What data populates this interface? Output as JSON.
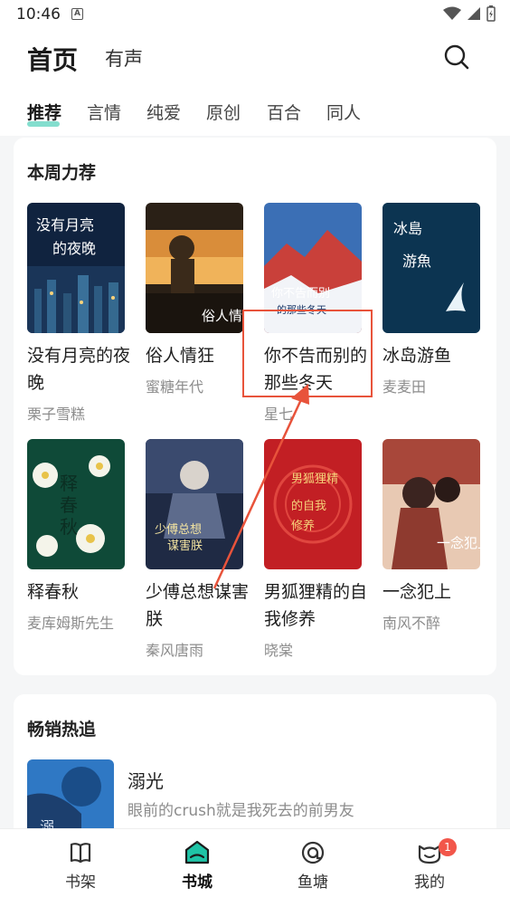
{
  "status_bar": {
    "time": "10:46",
    "notification_letter": "A"
  },
  "header": {
    "title": "首页",
    "audio_tab": "有声"
  },
  "category_tabs": [
    "推荐",
    "言情",
    "纯爱",
    "原创",
    "百合",
    "同人"
  ],
  "weekly_picks": {
    "title": "本周力荐",
    "books": [
      {
        "title": "没有月亮的夜晚",
        "author": "栗子雪糕",
        "cover_text": "没有月亮的夜晚"
      },
      {
        "title": "俗人情狂",
        "author": "蜜糖年代",
        "cover_text": "俗人情狂"
      },
      {
        "title": "你不告而别的那些冬天",
        "author": "星七",
        "cover_text": "你不告而别的那些冬天"
      },
      {
        "title": "冰岛游鱼",
        "author": "麦麦田",
        "cover_text": "冰岛游鱼"
      },
      {
        "title": "释春秋",
        "author": "麦库姆斯先生",
        "cover_text": "释春秋"
      },
      {
        "title": "少傅总想谋害朕",
        "author": "秦风唐雨",
        "cover_text": "少傅总想谋害朕"
      },
      {
        "title": "男狐狸精的自我修养",
        "author": "晓棠",
        "cover_text": "男狐狸精的自我修养"
      },
      {
        "title": "一念犯上",
        "author": "南风不醉",
        "cover_text": "一念犯上"
      }
    ]
  },
  "bestsellers": {
    "title": "畅销热追",
    "items": [
      {
        "title": "溺光",
        "description": "眼前的crush就是我死去的前男友",
        "cover_text": "溺"
      }
    ]
  },
  "bottom_nav": {
    "items": [
      {
        "label": "书架",
        "icon": "bookshelf-icon"
      },
      {
        "label": "书城",
        "icon": "bookstore-icon",
        "active": true
      },
      {
        "label": "鱼塘",
        "icon": "fishpond-icon"
      },
      {
        "label": "我的",
        "icon": "profile-icon",
        "badge": "1"
      }
    ]
  },
  "colors": {
    "accent": "#1fc3a6",
    "highlight_annotation": "#e8533b",
    "badge": "#f2564a"
  }
}
